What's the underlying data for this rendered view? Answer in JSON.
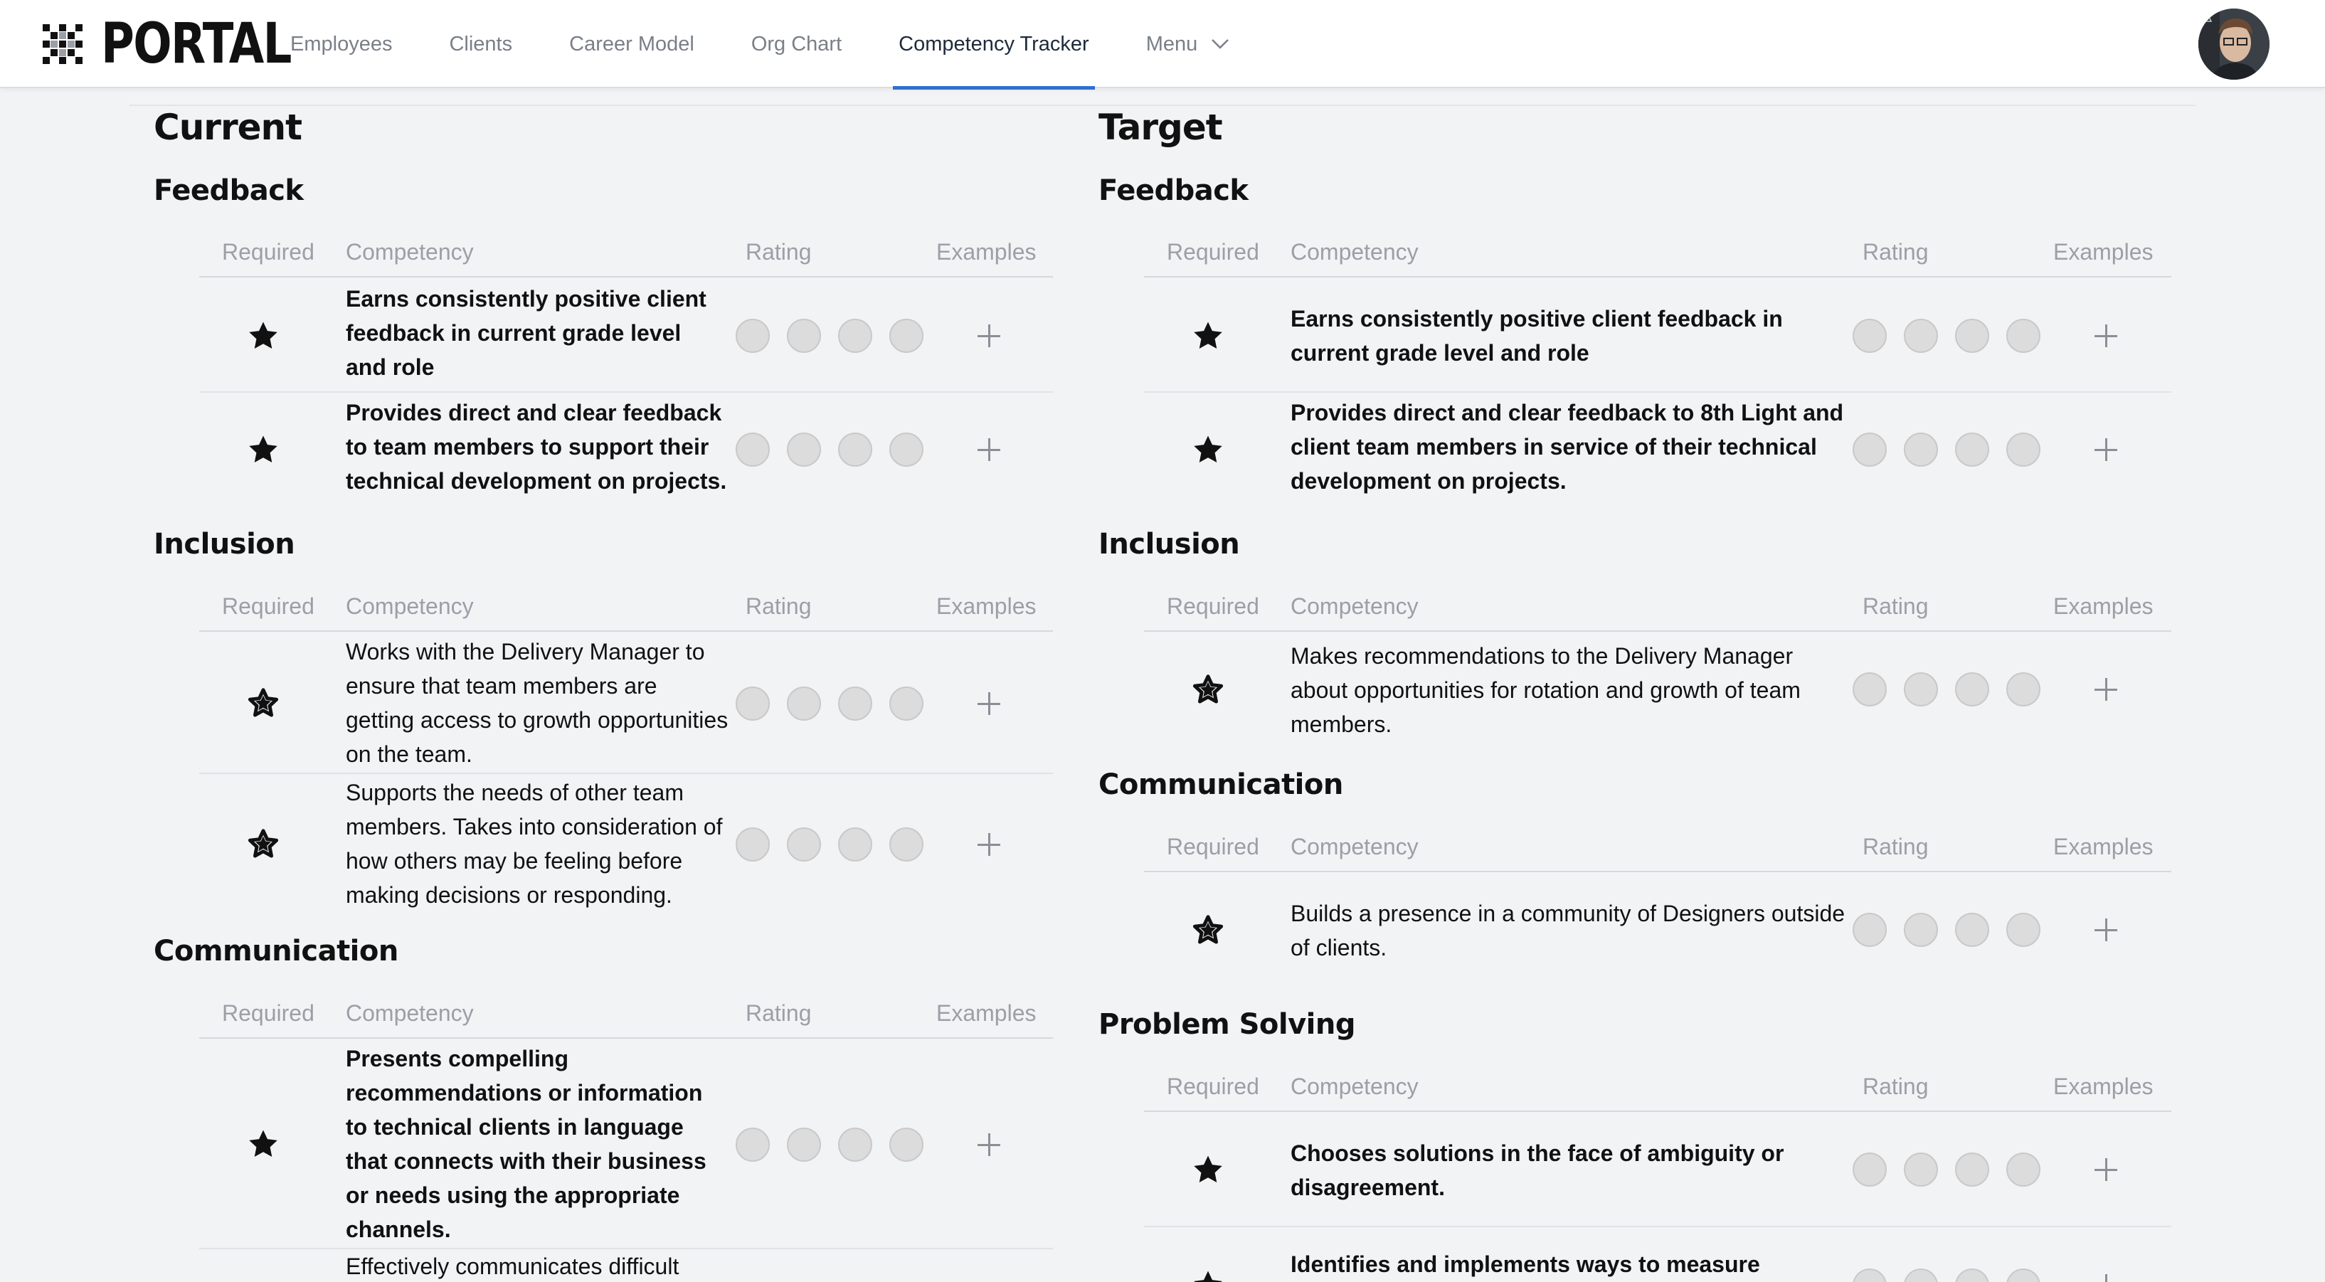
{
  "brand": {
    "name": "PORTAL"
  },
  "nav": {
    "items": [
      "Employees",
      "Clients",
      "Career Model",
      "Org Chart",
      "Competency Tracker"
    ],
    "active": "Competency Tracker",
    "menu_label": "Menu",
    "accent_color": "#2f6fcf"
  },
  "table_headers": {
    "required": "Required",
    "competency": "Competency",
    "rating": "Rating",
    "examples": "Examples"
  },
  "current": {
    "title": "Current",
    "sections": [
      {
        "title": "Feedback",
        "rows": [
          {
            "text": "Earns consistently positive client feedback in current grade level and role",
            "bold": true,
            "required": true,
            "rating": 0
          },
          {
            "text": "Provides direct and clear feedback to team members to support their technical development on projects.",
            "bold": true,
            "required": true,
            "rating": 0
          }
        ]
      },
      {
        "title": "Inclusion",
        "rows": [
          {
            "text": "Works with the Delivery Manager to ensure that team members are getting access to growth opportunities on the team.",
            "bold": false,
            "required": true,
            "rating": 0
          },
          {
            "text": "Supports the needs of other team members. Takes into consideration of how others may be feeling before making decisions or responding.",
            "bold": false,
            "required": true,
            "rating": 0
          }
        ]
      },
      {
        "title": "Communication",
        "rows": [
          {
            "text": "Presents compelling recommendations or information to technical clients in language that connects with their business or needs using the appropriate channels.",
            "bold": true,
            "required": true,
            "rating": 0
          },
          {
            "text": "Effectively communicates difficult",
            "bold": false,
            "required": true,
            "rating": 0
          }
        ]
      }
    ]
  },
  "target": {
    "title": "Target",
    "sections": [
      {
        "title": "Feedback",
        "rows": [
          {
            "text": "Earns consistently positive client feedback in current grade level and role",
            "bold": true,
            "required": true,
            "rating": 0
          },
          {
            "text": "Provides direct and clear feedback to 8th Light and client team members in service of their technical development on projects.",
            "bold": true,
            "required": true,
            "rating": 0
          }
        ]
      },
      {
        "title": "Inclusion",
        "rows": [
          {
            "text": "Makes recommendations to the Delivery Manager about opportunities for rotation and growth of team members.",
            "bold": false,
            "required": true,
            "rating": 0
          }
        ]
      },
      {
        "title": "Communication",
        "rows": [
          {
            "text": "Builds a presence in a community of Designers outside of clients.",
            "bold": false,
            "required": true,
            "rating": 0
          }
        ]
      },
      {
        "title": "Problem Solving",
        "rows": [
          {
            "text": "Chooses solutions in the face of ambiguity or disagreement.",
            "bold": true,
            "required": true,
            "rating": 0
          },
          {
            "text": "Identifies and implements ways to measure solution",
            "bold": true,
            "required": true,
            "rating": 0
          }
        ]
      }
    ]
  },
  "icons": {
    "required": "star-icon",
    "add_example": "plus-icon",
    "menu": "chevron-down-icon"
  },
  "colors": {
    "background": "#f2f3f5",
    "header": "#ffffff",
    "rating_dot": "#dcdcdc"
  }
}
